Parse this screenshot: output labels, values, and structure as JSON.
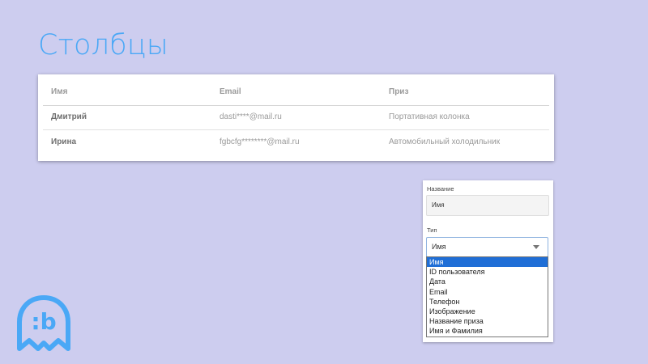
{
  "slide": {
    "title": "Столбцы"
  },
  "table": {
    "headers": [
      "Имя",
      "Email",
      "Приз"
    ],
    "rows": [
      [
        "Дмитрий",
        "dasti****@mail.ru",
        "Портативная колонка"
      ],
      [
        "Ирина",
        "fgbcfg********@mail.ru",
        "Автомобильный холодильник"
      ]
    ]
  },
  "settings": {
    "name_label": "Название",
    "name_value": "Имя",
    "type_label": "Тип",
    "type_value": "Имя",
    "options": [
      "Имя",
      "ID пользователя",
      "Дата",
      "Email",
      "Телефон",
      "Изображение",
      "Название приза",
      "Имя и Фамилия"
    ],
    "selected_index": 0
  },
  "logo": {
    "text": ":b",
    "icon": "brand-logo-icon",
    "color": "#4aa8f6"
  },
  "colors": {
    "background": "#cdcdef",
    "accent": "#4aa8f6",
    "selection": "#1f6ed6"
  }
}
